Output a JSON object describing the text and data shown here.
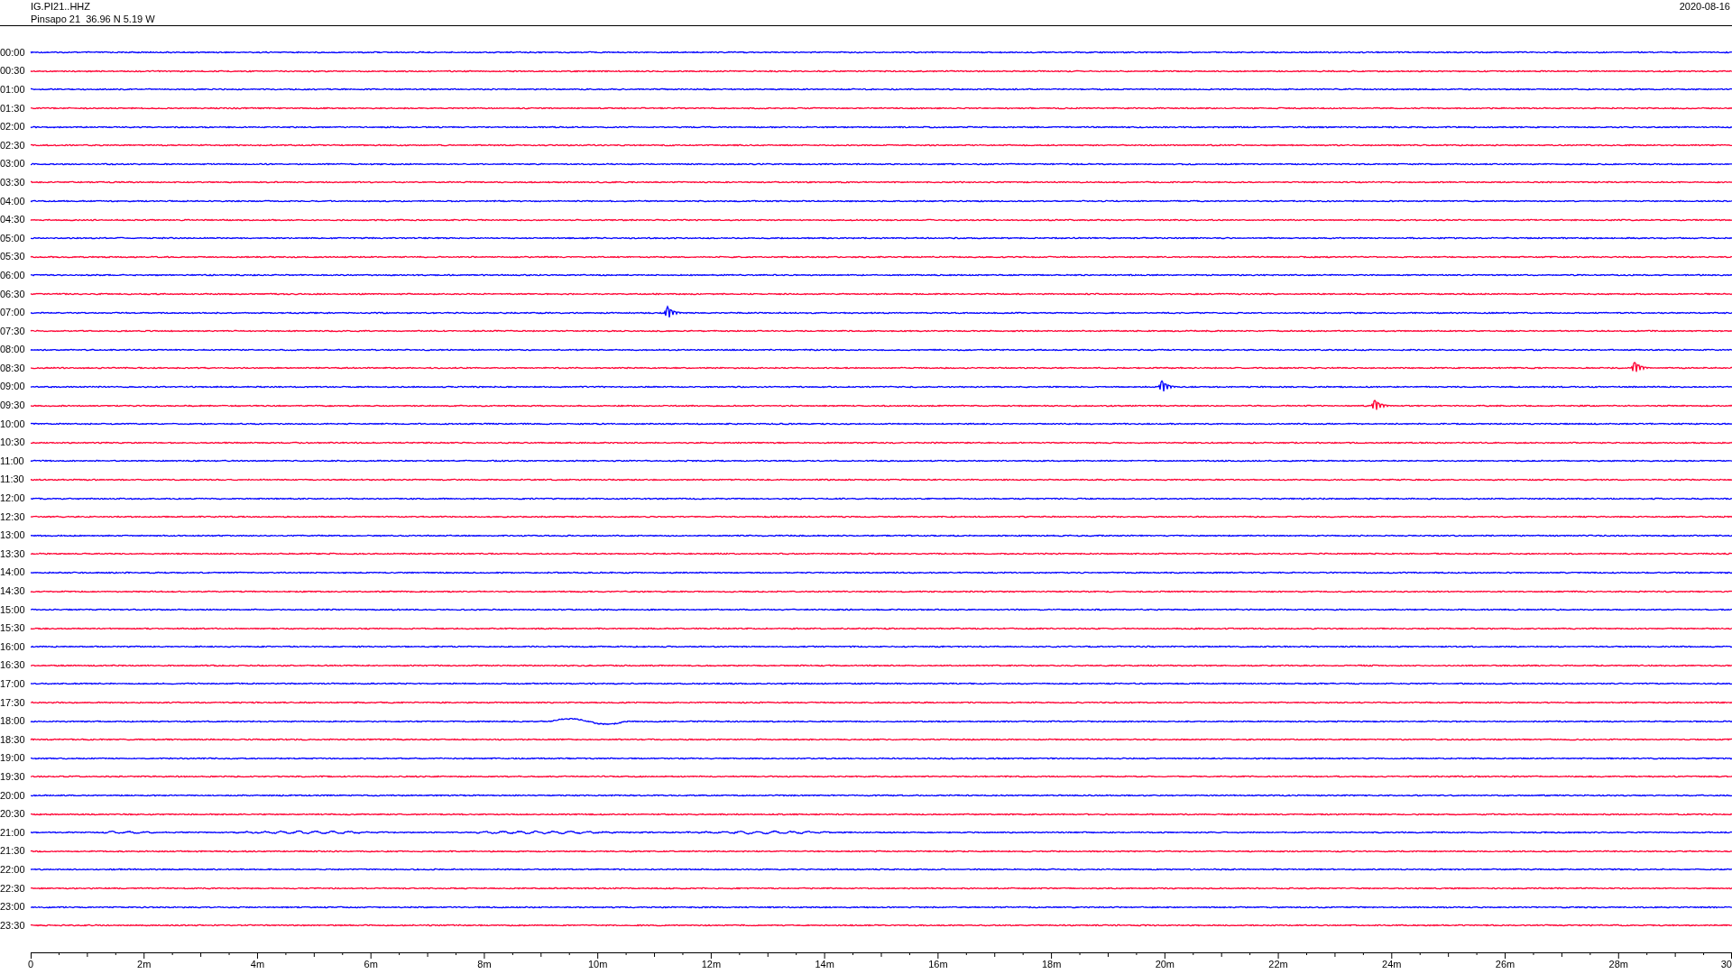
{
  "header": {
    "station_code": "IG.PI21..HHZ",
    "station_info": "Pinsapo 21  36.96 N 5.19 W",
    "date": "2020-08-16"
  },
  "rows": [
    {
      "label": "00:00",
      "color": "#0000ff"
    },
    {
      "label": "00:30",
      "color": "#ff0033"
    },
    {
      "label": "01:00",
      "color": "#0000ff"
    },
    {
      "label": "01:30",
      "color": "#ff0033"
    },
    {
      "label": "02:00",
      "color": "#0000ff"
    },
    {
      "label": "02:30",
      "color": "#ff0033"
    },
    {
      "label": "03:00",
      "color": "#0000ff"
    },
    {
      "label": "03:30",
      "color": "#ff0033"
    },
    {
      "label": "04:00",
      "color": "#0000ff"
    },
    {
      "label": "04:30",
      "color": "#ff0033"
    },
    {
      "label": "05:00",
      "color": "#0000ff"
    },
    {
      "label": "05:30",
      "color": "#ff0033"
    },
    {
      "label": "06:00",
      "color": "#0000ff"
    },
    {
      "label": "06:30",
      "color": "#ff0033"
    },
    {
      "label": "07:00",
      "color": "#0000ff"
    },
    {
      "label": "07:30",
      "color": "#ff0033"
    },
    {
      "label": "08:00",
      "color": "#0000ff"
    },
    {
      "label": "08:30",
      "color": "#ff0033"
    },
    {
      "label": "09:00",
      "color": "#0000ff"
    },
    {
      "label": "09:30",
      "color": "#ff0033"
    },
    {
      "label": "10:00",
      "color": "#0000ff"
    },
    {
      "label": "10:30",
      "color": "#ff0033"
    },
    {
      "label": "11:00",
      "color": "#0000ff"
    },
    {
      "label": "11:30",
      "color": "#ff0033"
    },
    {
      "label": "12:00",
      "color": "#0000ff"
    },
    {
      "label": "12:30",
      "color": "#ff0033"
    },
    {
      "label": "13:00",
      "color": "#0000ff"
    },
    {
      "label": "13:30",
      "color": "#ff0033"
    },
    {
      "label": "14:00",
      "color": "#0000ff"
    },
    {
      "label": "14:30",
      "color": "#ff0033"
    },
    {
      "label": "15:00",
      "color": "#0000ff"
    },
    {
      "label": "15:30",
      "color": "#ff0033"
    },
    {
      "label": "16:00",
      "color": "#0000ff"
    },
    {
      "label": "16:30",
      "color": "#ff0033"
    },
    {
      "label": "17:00",
      "color": "#0000ff"
    },
    {
      "label": "17:30",
      "color": "#ff0033"
    },
    {
      "label": "18:00",
      "color": "#0000ff"
    },
    {
      "label": "18:30",
      "color": "#ff0033"
    },
    {
      "label": "19:00",
      "color": "#0000ff"
    },
    {
      "label": "19:30",
      "color": "#ff0033"
    },
    {
      "label": "20:00",
      "color": "#0000ff"
    },
    {
      "label": "20:30",
      "color": "#ff0033"
    },
    {
      "label": "21:00",
      "color": "#0000ff"
    },
    {
      "label": "21:30",
      "color": "#ff0033"
    },
    {
      "label": "22:00",
      "color": "#0000ff"
    },
    {
      "label": "22:30",
      "color": "#ff0033"
    },
    {
      "label": "23:00",
      "color": "#0000ff"
    },
    {
      "label": "23:30",
      "color": "#ff0033"
    }
  ],
  "x_axis_labels": [
    "0",
    "2m",
    "4m",
    "6m",
    "8m",
    "10m",
    "12m",
    "14m",
    "16m",
    "18m",
    "20m",
    "22m",
    "24m",
    "26m",
    "28m",
    "30"
  ]
}
